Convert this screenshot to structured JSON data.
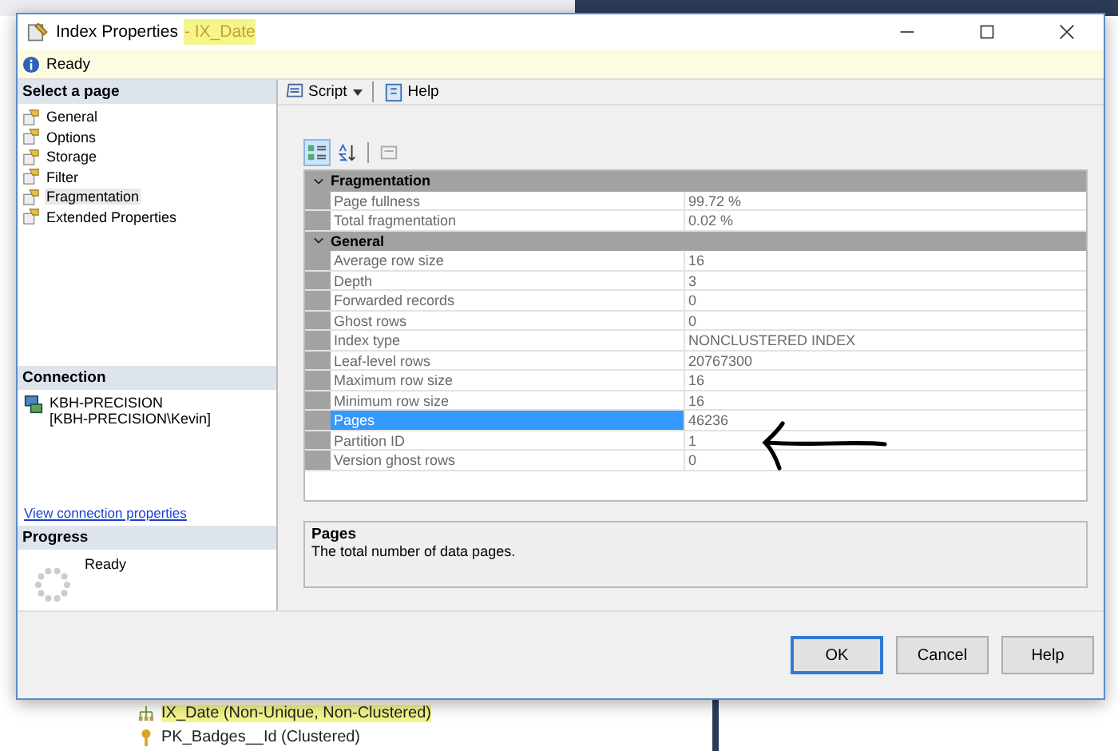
{
  "window": {
    "title": "Index Properties",
    "title_suffix": "- IX_Date",
    "suffix_highlighted": true
  },
  "status": "Ready",
  "sidebar": {
    "header": "Select a page",
    "items": [
      {
        "label": "General",
        "selected": false
      },
      {
        "label": "Options",
        "selected": false
      },
      {
        "label": "Storage",
        "selected": false
      },
      {
        "label": "Filter",
        "selected": false
      },
      {
        "label": "Fragmentation",
        "selected": true
      },
      {
        "label": "Extended Properties",
        "selected": false
      }
    ]
  },
  "connection": {
    "header": "Connection",
    "server": "KBH-PRECISION",
    "user": "[KBH-PRECISION\\Kevin]",
    "link": "View connection properties"
  },
  "progress": {
    "header": "Progress",
    "status": "Ready"
  },
  "toolbar": {
    "script": "Script",
    "help": "Help"
  },
  "grid": {
    "categories": [
      {
        "name": "Fragmentation",
        "expanded": true,
        "rows": [
          {
            "name": "Page fullness",
            "value": "99.72 %",
            "selected": false
          },
          {
            "name": "Total fragmentation",
            "value": "0.02 %",
            "selected": false
          }
        ]
      },
      {
        "name": "General",
        "expanded": true,
        "rows": [
          {
            "name": "Average row size",
            "value": "16",
            "selected": false
          },
          {
            "name": "Depth",
            "value": "3",
            "selected": false
          },
          {
            "name": "Forwarded records",
            "value": "0",
            "selected": false
          },
          {
            "name": "Ghost rows",
            "value": "0",
            "selected": false
          },
          {
            "name": "Index type",
            "value": "NONCLUSTERED INDEX",
            "selected": false
          },
          {
            "name": "Leaf-level rows",
            "value": "20767300",
            "selected": false
          },
          {
            "name": "Maximum row size",
            "value": "16",
            "selected": false
          },
          {
            "name": "Minimum row size",
            "value": "16",
            "selected": false
          },
          {
            "name": "Pages",
            "value": "46236",
            "selected": true
          },
          {
            "name": "Partition ID",
            "value": "1",
            "selected": false
          },
          {
            "name": "Version ghost rows",
            "value": "0",
            "selected": false
          }
        ]
      }
    ]
  },
  "description": {
    "title": "Pages",
    "text": "The total number of data pages."
  },
  "buttons": [
    {
      "label": "OK",
      "default": true
    },
    {
      "label": "Cancel",
      "default": false
    },
    {
      "label": "Help",
      "default": false
    }
  ],
  "background_tree": [
    {
      "label": "IX_Date (Non-Unique, Non-Clustered)",
      "kind": "index",
      "highlighted": true
    },
    {
      "label": "PK_Badges__Id (Clustered)",
      "kind": "key",
      "highlighted": false
    }
  ]
}
